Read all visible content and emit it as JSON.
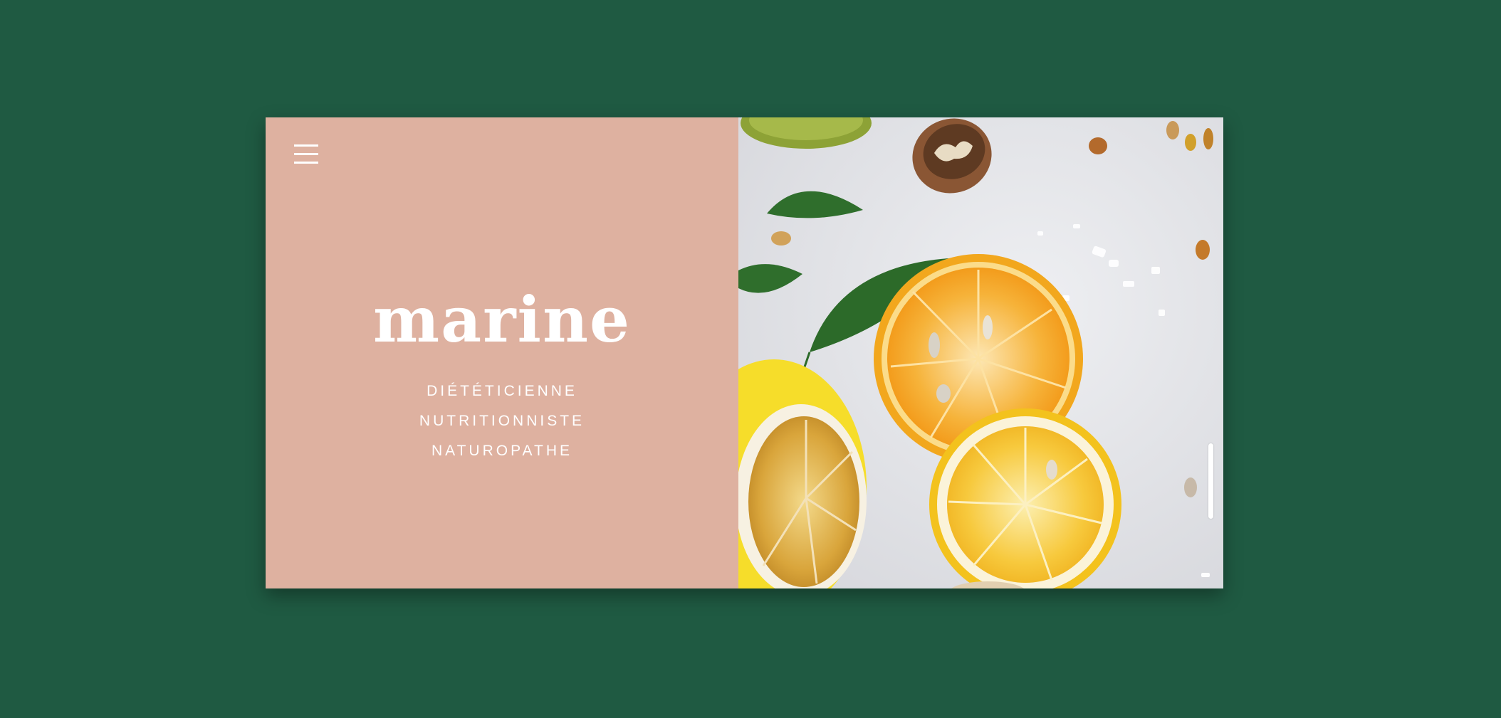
{
  "colors": {
    "background": "#1f5a42",
    "left_panel": "#deb1a0",
    "text": "#ffffff"
  },
  "menu": {
    "icon": "hamburger-menu-icon"
  },
  "brand": {
    "name": "marine",
    "taglines": [
      "DIÉTÉTICIENNE",
      "NUTRITIONNISTE",
      "NATUROPATHE"
    ]
  },
  "hero_image": {
    "subject": "sliced citrus, leaves, walnut and seeds on white surface"
  }
}
